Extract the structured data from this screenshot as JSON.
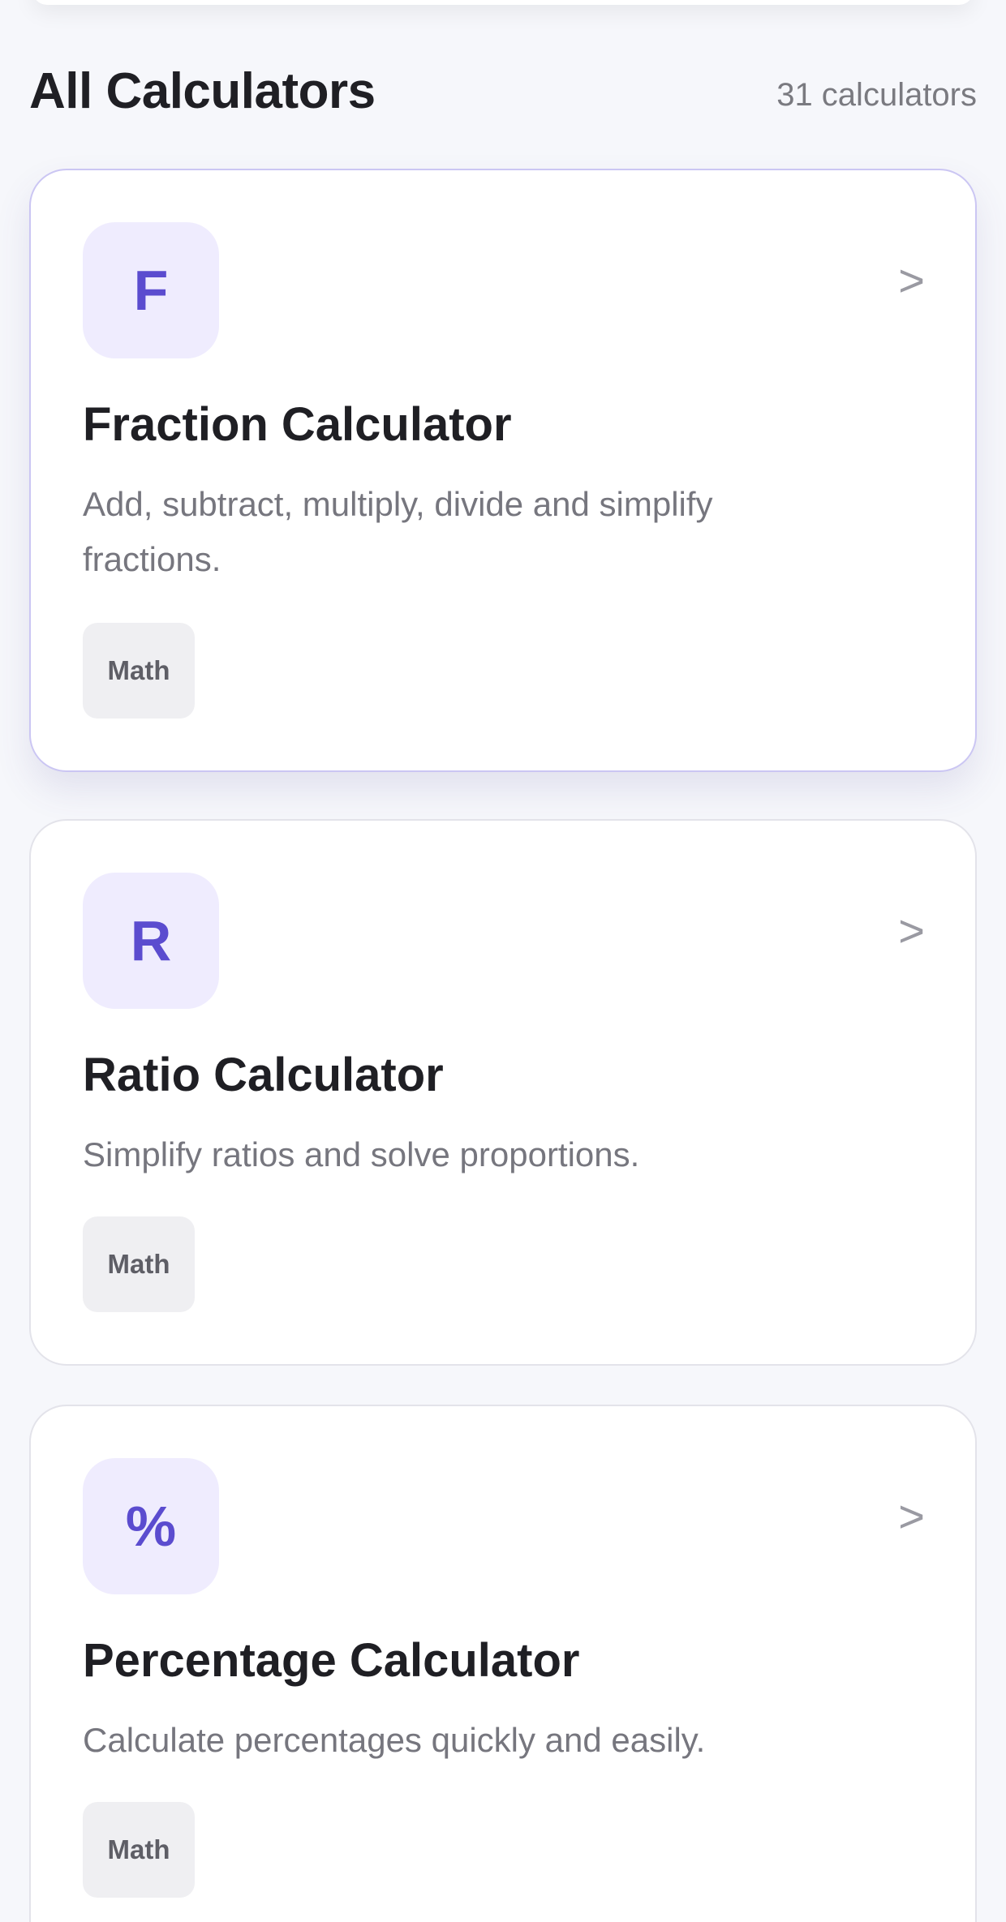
{
  "header": {
    "title": "All Calculators",
    "count": "31 calculators"
  },
  "calculators": [
    {
      "icon_letter": "F",
      "title": "Fraction Calculator",
      "description": "Add, subtract, multiply, divide and simplify fractions.",
      "tag": "Math",
      "chevron": ">"
    },
    {
      "icon_letter": "R",
      "title": "Ratio Calculator",
      "description": "Simplify ratios and solve proportions.",
      "tag": "Math",
      "chevron": ">"
    },
    {
      "icon_letter": "%",
      "title": "Percentage Calculator",
      "description": "Calculate percentages quickly and easily.",
      "tag": "Math",
      "chevron": ">"
    }
  ],
  "colors": {
    "accent": "#5b4ccf",
    "icon_bg": "#efecfe",
    "background": "#f6f7fb",
    "card_border_active": "#cbc6f3"
  }
}
